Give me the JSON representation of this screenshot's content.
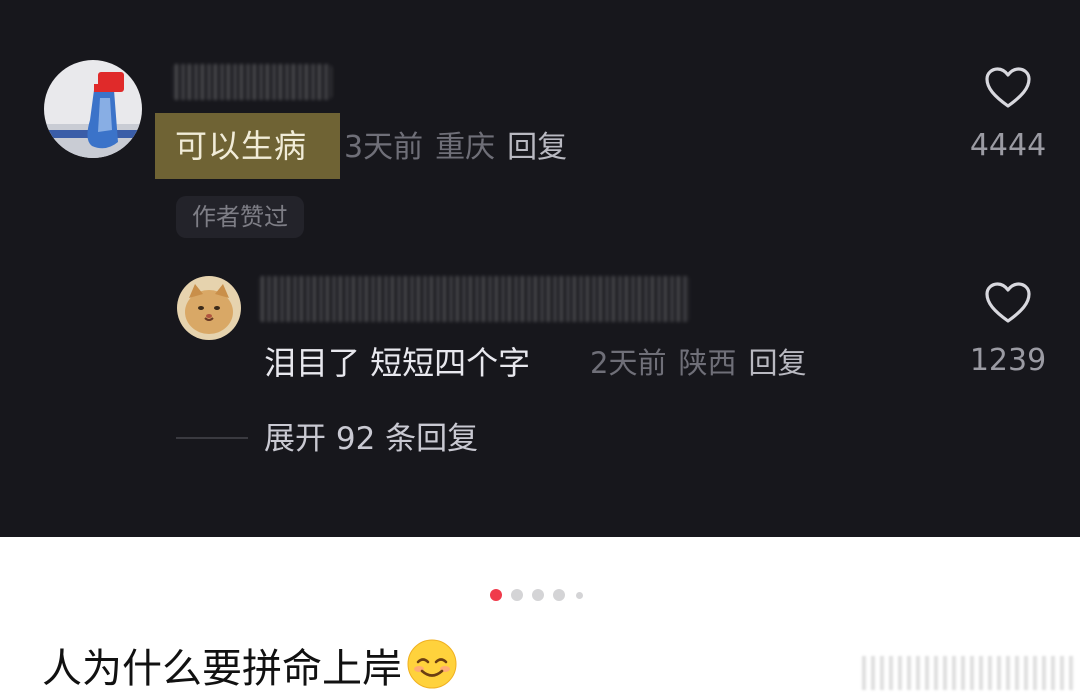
{
  "comment": {
    "text": "可以生病",
    "time": "3天前",
    "location": "重庆",
    "reply_label": "回复",
    "author_badge": "作者赞过",
    "likes": "4444"
  },
  "reply": {
    "text": "泪目了 短短四个字",
    "time": "2天前",
    "location": "陕西",
    "reply_label": "回复",
    "likes": "1239"
  },
  "expand_replies": "展开 92 条回复",
  "pager": {
    "total": 5,
    "active_index": 0,
    "active_color": "#f03a4b"
  },
  "post": {
    "title": "人为什么要拼命上岸",
    "emoji": "smiling-face-emoji"
  },
  "colors": {
    "screenshot_bg": "#17171c",
    "highlight_bg": "#6f6334",
    "meta_text": "#6f6f78"
  }
}
